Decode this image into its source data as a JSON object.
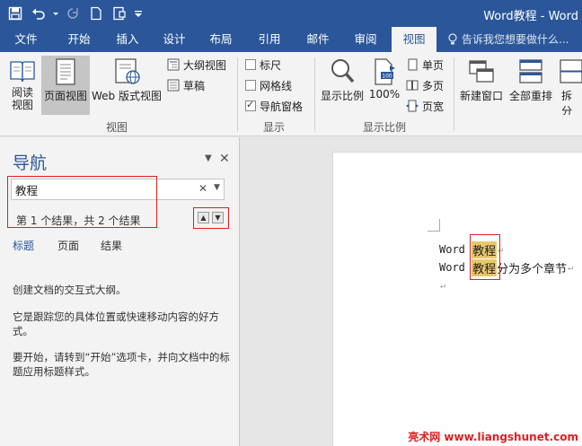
{
  "window": {
    "title": "Word教程 - Word"
  },
  "quick_access": {
    "icons": [
      "save-icon",
      "undo-icon",
      "redo-icon",
      "new-document-icon",
      "touch-mode-icon",
      "customize-icon"
    ]
  },
  "tabs": [
    {
      "label": "文件"
    },
    {
      "label": "开始"
    },
    {
      "label": "插入"
    },
    {
      "label": "设计"
    },
    {
      "label": "布局"
    },
    {
      "label": "引用"
    },
    {
      "label": "邮件"
    },
    {
      "label": "审阅"
    },
    {
      "label": "视图",
      "active": true
    }
  ],
  "tell_me": {
    "placeholder": "告诉我您想要做什么..."
  },
  "ribbon": {
    "views": {
      "read_mode": "阅读\n视图",
      "read_mode_l1": "阅读",
      "read_mode_l2": "视图",
      "print_layout": "页面视图",
      "web_layout": "Web 版式视图",
      "outline": "大纲视图",
      "draft": "草稿",
      "group_label": "视图"
    },
    "show": {
      "ruler": "标尺",
      "ruler_checked": false,
      "gridlines": "网格线",
      "gridlines_checked": false,
      "nav_pane": "导航窗格",
      "nav_pane_checked": true,
      "group_label": "显示"
    },
    "zoom": {
      "zoom": "显示比例",
      "hundred": "100%",
      "one_page": "单页",
      "multi_page": "多页",
      "page_width": "页宽",
      "group_label": "显示比例"
    },
    "window": {
      "new_window": "新建窗口",
      "arrange_all": "全部重排",
      "split": "拆分"
    }
  },
  "navigation": {
    "title": "导航",
    "search_value": "教程",
    "result_text": "第 1 个结果，共 2 个结果",
    "tabs": [
      "标题",
      "页面",
      "结果"
    ],
    "active_tab": 0,
    "paragraphs": [
      "创建文档的交互式大纲。",
      "它是跟踪您的具体位置或快速移动内容的好方式。",
      "要开始，请转到“开始”选项卡，并向文档中的标题应用标题样式。"
    ]
  },
  "document": {
    "lines": [
      {
        "prefix": "Word ",
        "highlight": "教程",
        "suffix": ""
      },
      {
        "prefix": "Word ",
        "highlight": "教程",
        "suffix": "分为多个章节"
      }
    ]
  },
  "watermark": "亮术网 www.liangshunet.com",
  "colors": {
    "accent": "#2b579a",
    "highlight": "#e8c86a",
    "annotation": "#e01e1e"
  }
}
